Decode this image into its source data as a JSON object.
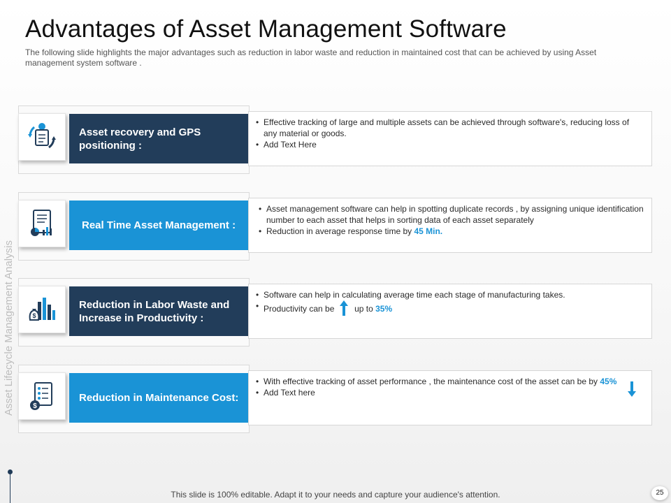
{
  "slide": {
    "title": "Advantages of Asset Management Software",
    "subtitle": "The following slide highlights the major advantages  such as reduction in labor waste and reduction in maintained cost that can be achieved  by using Asset management  system software .",
    "side_label": "Asset Lifecycle Management Analysis",
    "footer": "This slide is 100% editable. Adapt it to your needs and capture your audience's attention.",
    "page_number": "25"
  },
  "rows": [
    {
      "icon": "asset-recovery-icon",
      "label": "Asset recovery and GPS positioning :",
      "bullets": [
        "Effective tracking of large and multiple assets can be achieved  through software's, reducing loss of any material or goods.",
        "Add Text Here"
      ]
    },
    {
      "icon": "report-chart-icon",
      "label": "Real Time Asset Management :",
      "bullets": [
        "Asset management  software  can help in  spotting duplicate records  , by assigning unique identification number to each asset that helps in sorting data of each asset separately",
        " Reduction in average  response  time by"
      ],
      "highlight": "45 Min."
    },
    {
      "icon": "money-growth-icon",
      "label": "Reduction in Labor Waste and Increase in Productivity :",
      "bullets": [
        "Software can help in calculating average  time each stage of manufacturing takes.",
        "Productivity can be"
      ],
      "bullet_suffix": "up to",
      "highlight": "35%"
    },
    {
      "icon": "maintenance-cost-icon",
      "label": "Reduction in Maintenance Cost:",
      "bullets": [
        "With effective  tracking of asset performance   , the maintenance cost of the  asset can be by",
        "Add Text here"
      ],
      "highlight": "45%"
    }
  ],
  "colors": {
    "dark_navy": "#223d5a",
    "accent_blue": "#1a93d6"
  }
}
